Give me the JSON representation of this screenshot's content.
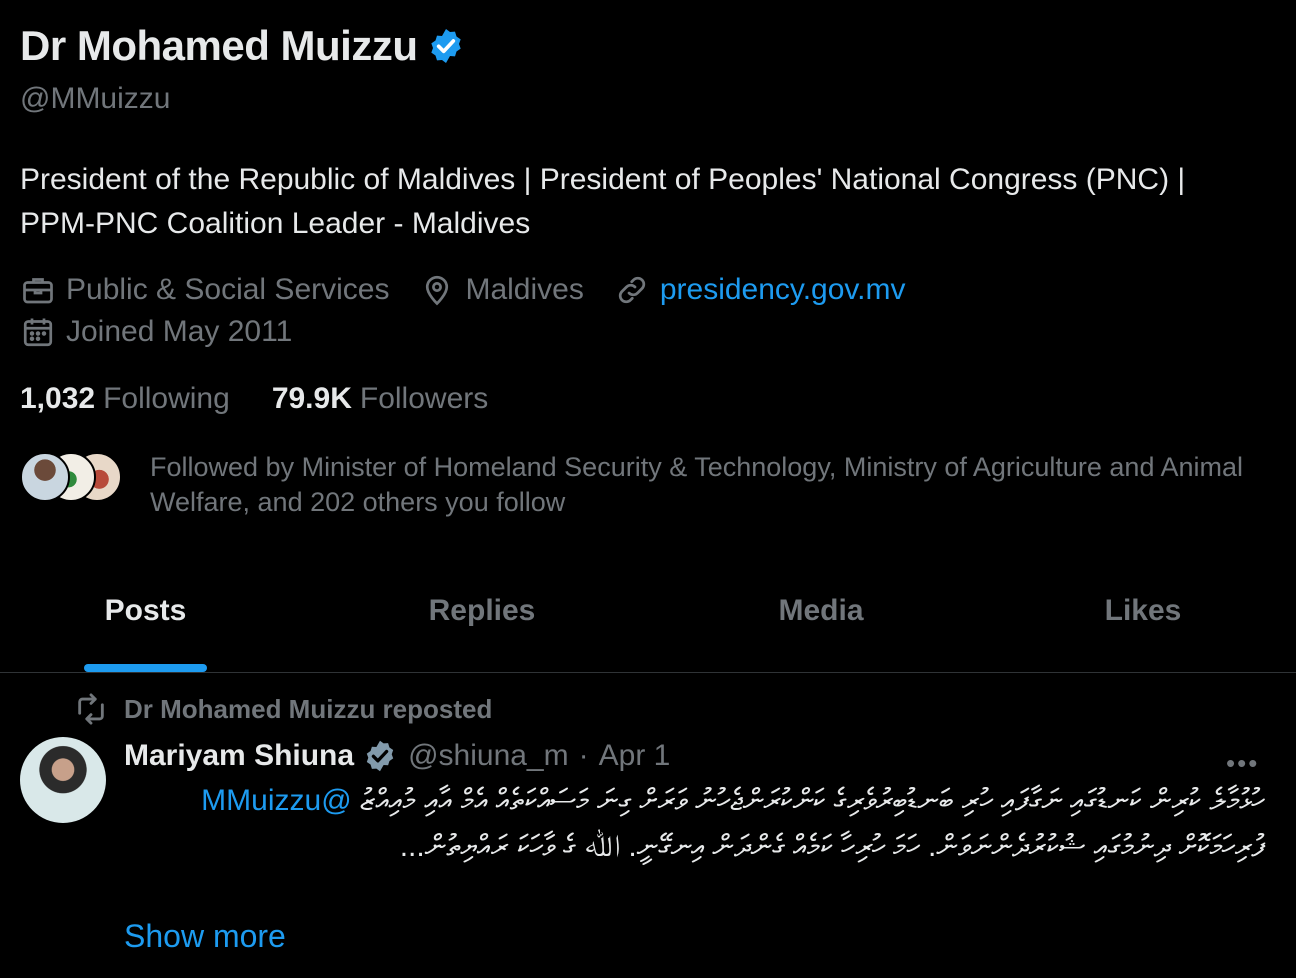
{
  "profile": {
    "name": "Dr Mohamed Muizzu",
    "handle": "@MMuizzu",
    "bio": "President of the Republic of Maldives | President of Peoples' National Congress (PNC) | PPM-PNC Coalition Leader - Maldives",
    "category": "Public & Social Services",
    "location": "Maldives",
    "website": "presidency.gov.mv",
    "joined": "Joined May 2011",
    "following_count": "1,032",
    "following_label": "Following",
    "followers_count": "79.9K",
    "followers_label": "Followers",
    "followed_by": "Followed by Minister of Homeland Security & Technology, Ministry of Agriculture and Animal Welfare, and 202 others you follow"
  },
  "tabs": [
    "Posts",
    "Replies",
    "Media",
    "Likes"
  ],
  "post": {
    "repost_label": "Dr Mohamed Muizzu reposted",
    "author": "Mariyam Shiuna",
    "handle": "@shiuna_m",
    "dot": "·",
    "date": "Apr 1",
    "more": "•••",
    "text_part1": "ހުޅުމާލެ ކުރިން ކަނޑުގައި ނަގާފައި ހުރި ބަނޑުބިރުވެރިގެ ކަންކުރަންޖެހުނު ވަރަށް ގިނަ މަސައްކަތެއް އެމް އާއި މުއިއްޒު",
    "text_mention": "@MMuizzu",
    "text_part2": "ފުރިހަމަކޮށް ދިނުމުގައި ޝުކުރުދެންނަވަން. ހަމަ ހުރިހާ ކަމެއް ގެންދަން އިނގޭނީ. ﷲ ގެ ވާހަކަ ރައްޔިތުން...",
    "show_more": "Show more"
  },
  "colors": {
    "background": "#000000",
    "text": "#e7e9ea",
    "muted": "#71767b",
    "accent": "#1d9bf0",
    "divider": "#2f3336"
  },
  "icons": [
    "verified-badge-icon",
    "briefcase-icon",
    "location-pin-icon",
    "link-icon",
    "calendar-icon",
    "repost-icon",
    "more-icon"
  ]
}
